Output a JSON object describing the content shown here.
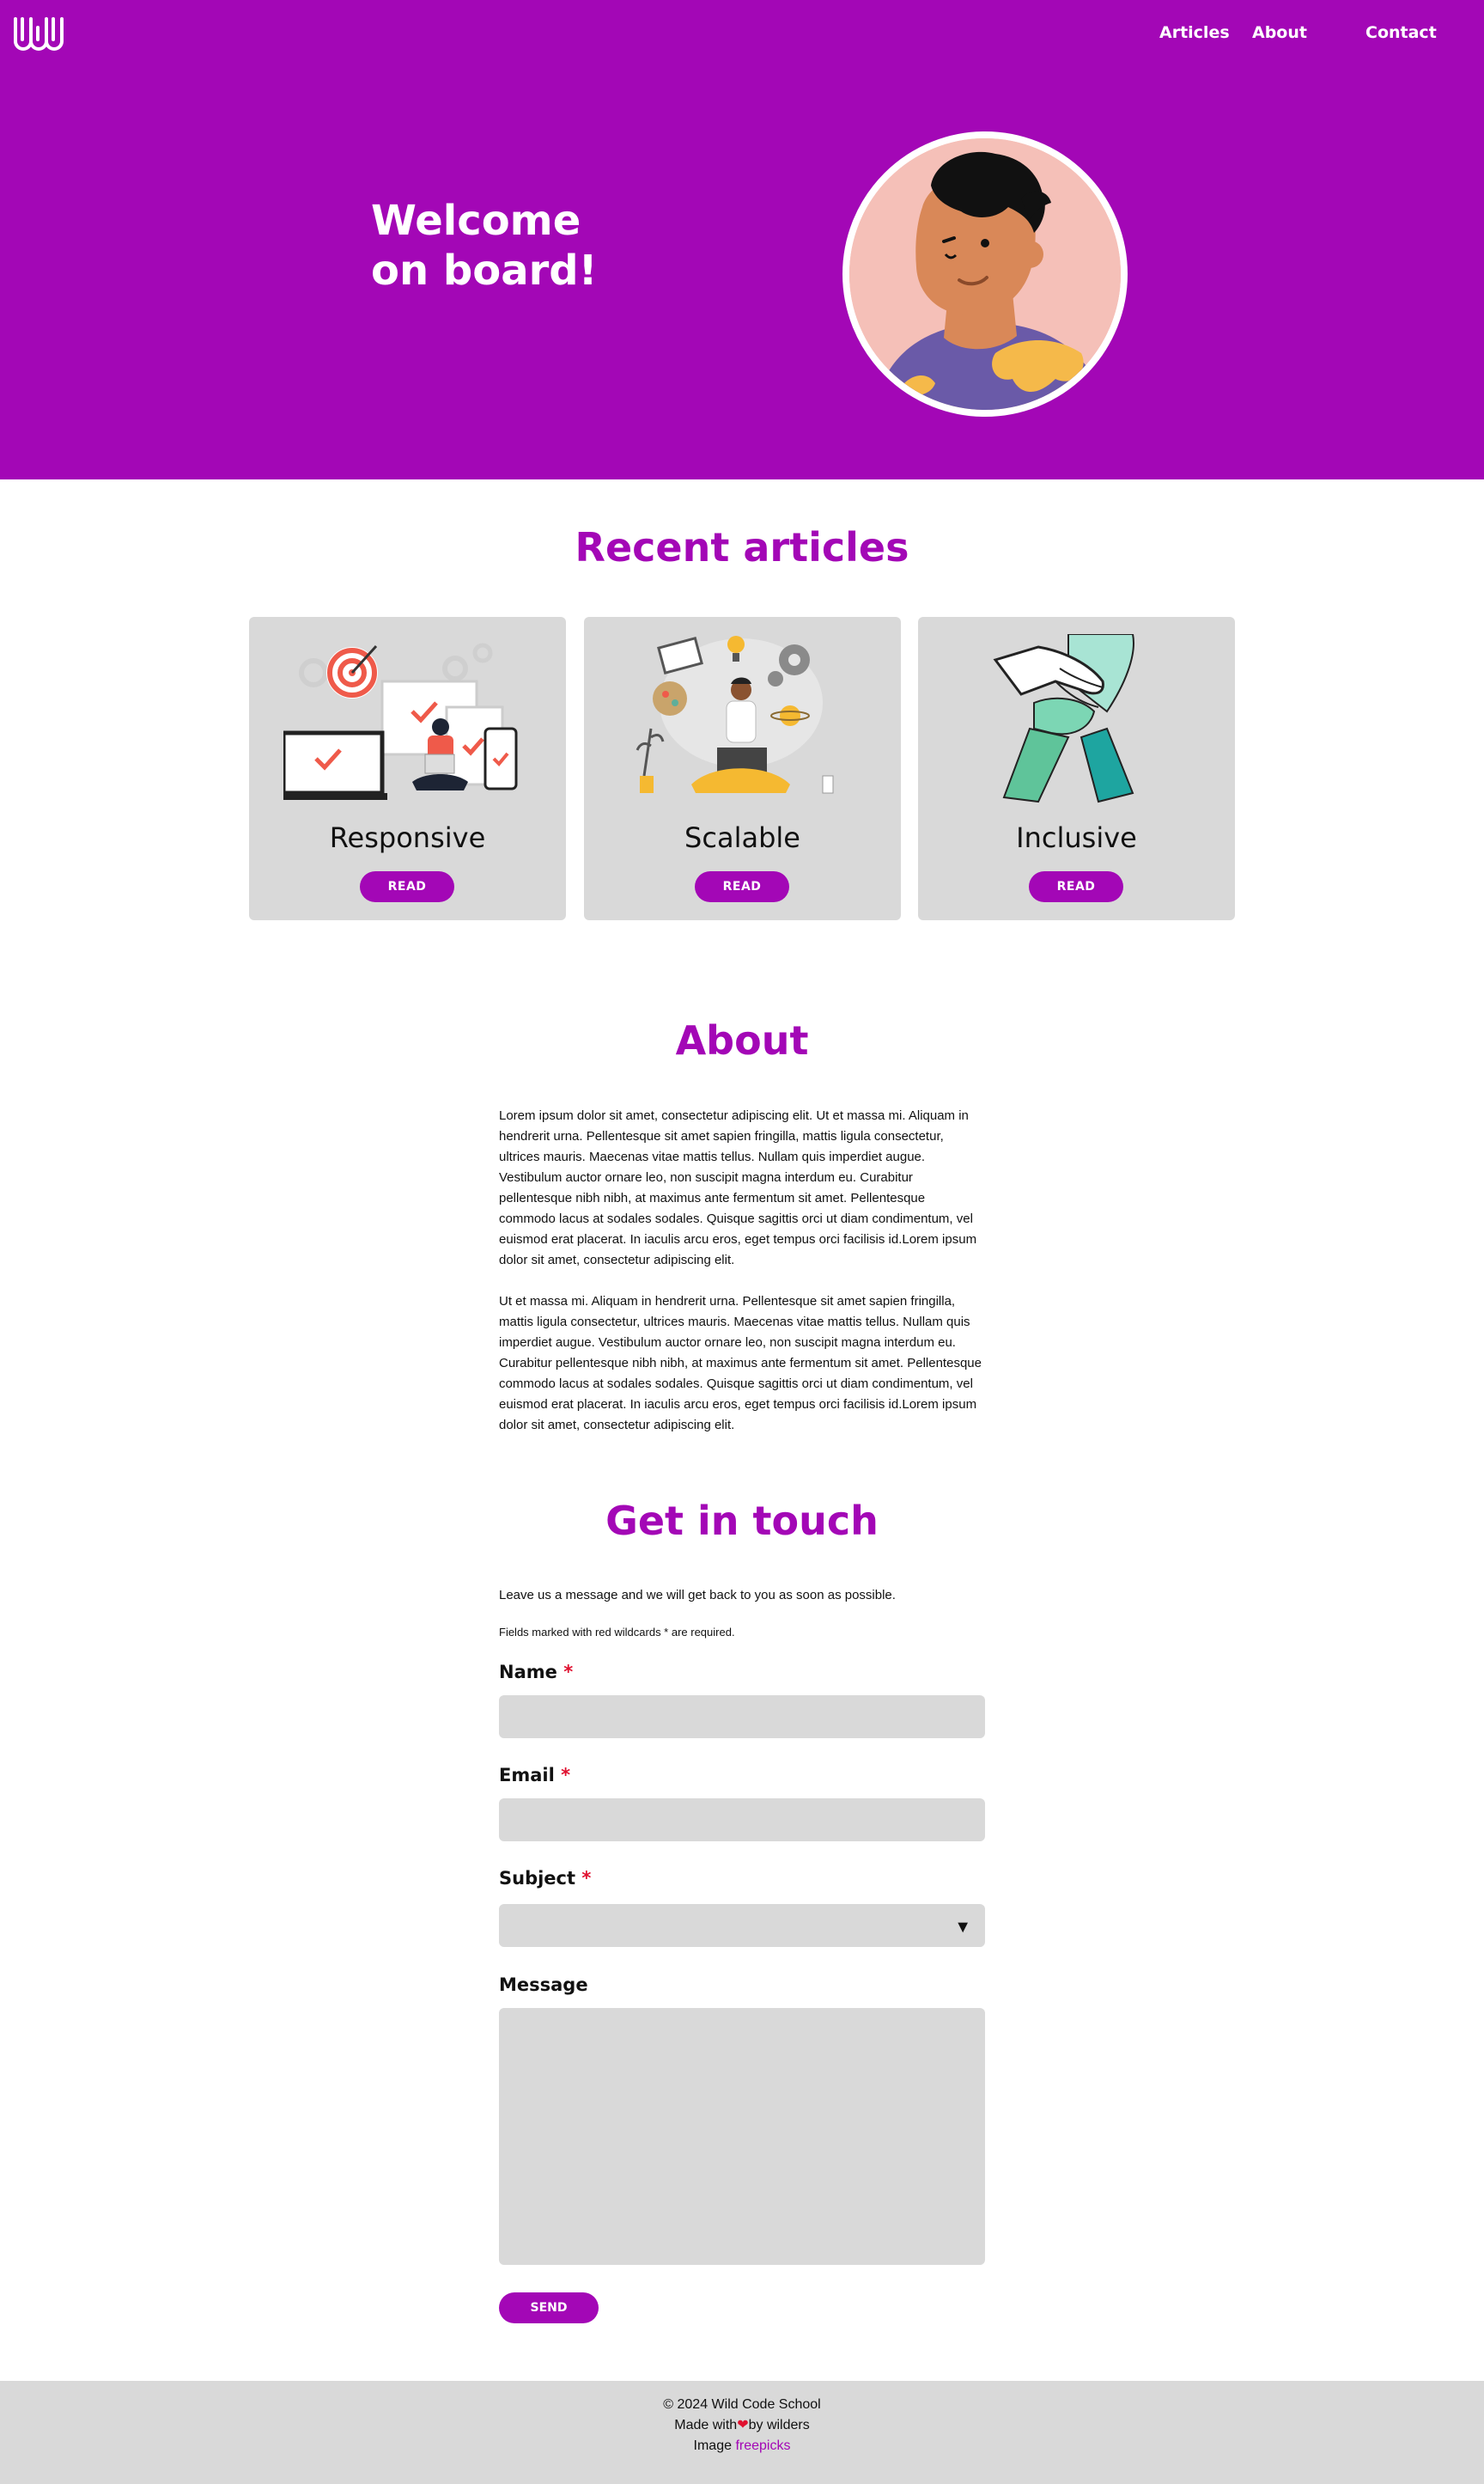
{
  "header": {
    "logo_label": "Wild Code School logo",
    "nav": [
      {
        "label": "Articles"
      },
      {
        "label": "About"
      },
      {
        "label": "Contact"
      }
    ]
  },
  "hero": {
    "title_line1": "Welcome",
    "title_line2": "on board!"
  },
  "articles": {
    "title": "Recent articles",
    "cards": [
      {
        "title": "Responsive",
        "button": "READ"
      },
      {
        "title": "Scalable",
        "button": "READ"
      },
      {
        "title": "Inclusive",
        "button": "READ"
      }
    ]
  },
  "about": {
    "title": "About",
    "paragraphs": [
      "Lorem ipsum dolor sit amet, consectetur adipiscing elit. Ut et massa mi. Aliquam in hendrerit urna. Pellentesque sit amet sapien fringilla, mattis ligula consectetur, ultrices mauris. Maecenas vitae mattis tellus. Nullam quis imperdiet augue. Vestibulum auctor ornare leo, non suscipit magna interdum eu. Curabitur pellentesque nibh nibh, at maximus ante fermentum sit amet. Pellentesque commodo lacus at sodales sodales. Quisque sagittis orci ut diam condimentum, vel euismod erat placerat. In iaculis arcu eros, eget tempus orci facilisis id.Lorem ipsum dolor sit amet, consectetur adipiscing elit.",
      "Ut et massa mi. Aliquam in hendrerit urna. Pellentesque sit amet sapien fringilla, mattis ligula consectetur, ultrices mauris. Maecenas vitae mattis tellus. Nullam quis imperdiet augue. Vestibulum auctor ornare leo, non suscipit magna interdum eu. Curabitur pellentesque nibh nibh, at maximus ante fermentum sit amet. Pellentesque commodo lacus at sodales sodales. Quisque sagittis orci ut diam condimentum, vel euismod erat placerat. In iaculis arcu eros, eget tempus orci facilisis id.Lorem ipsum dolor sit amet, consectetur adipiscing elit."
    ]
  },
  "contact": {
    "title": "Get in touch",
    "intro": "Leave us a message and we will get back to you as soon as possible.",
    "required_note": "Fields marked with red wildcards * are required.",
    "required_mark": "*",
    "name_label": "Name",
    "email_label": "Email",
    "subject_label": "Subject",
    "subject_arrow": "▼",
    "message_label": "Message",
    "send_label": "SEND"
  },
  "footer": {
    "copyright": "© 2024 Wild Code School",
    "made_with_prefix": "Made with",
    "heart": "❤",
    "made_with_suffix": "by wilders",
    "image_prefix": "Image",
    "image_link": "freepicks"
  },
  "colors": {
    "brand": "#a307b6",
    "card_bg": "#d9d9d9",
    "required": "#e0102f"
  }
}
